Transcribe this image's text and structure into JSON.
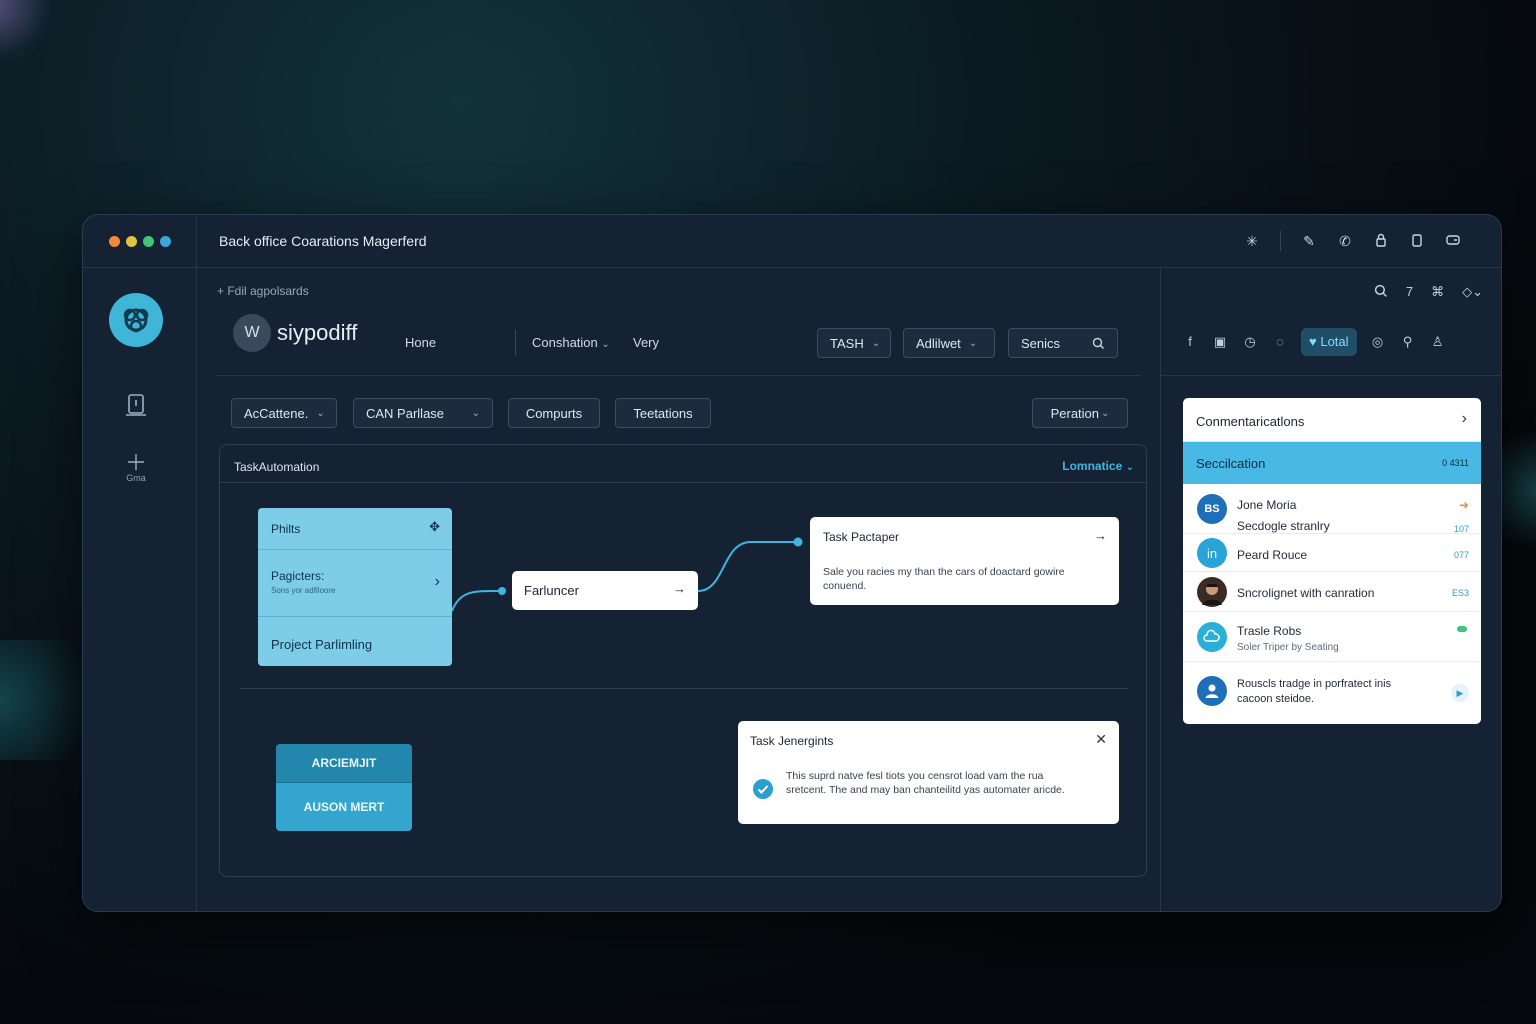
{
  "window": {
    "title": "Back office Coarations Magerferd",
    "dots": [
      "#f08a3c",
      "#e3c33a",
      "#3fc47a",
      "#3aa8d8"
    ],
    "title_icons": [
      "asterisk-icon",
      "tools-icon",
      "phone-icon",
      "lock-icon",
      "clipboard-icon",
      "link-icon"
    ]
  },
  "leftbar": {
    "icons": [
      "logo-icon",
      "badge-icon",
      "plus-icon"
    ],
    "label": "Gma"
  },
  "main": {
    "breadcrumb": "+ Fdil agpolsards",
    "brand_badge": "W",
    "brand_name": "siypodiff",
    "nav": [
      "Hone",
      "Conshation",
      "Very"
    ],
    "buttons": [
      {
        "label": "TASH"
      },
      {
        "label": "Adlilwet"
      },
      {
        "label": "Senics"
      }
    ],
    "filters": [
      {
        "label": "AcCattene."
      },
      {
        "label": "CAN Parllase"
      },
      {
        "label": "Compurts"
      },
      {
        "label": "Teetations"
      }
    ],
    "filter_right": "Peration",
    "panel": {
      "title": "TaskAutomation",
      "right_label": "Lomnatice",
      "node_list": {
        "header": "Philts",
        "row2_title": "Pagicters:",
        "row2_sub": "Sons yor adfiloore",
        "row3": "Project Parlimling"
      },
      "node_mid": "Farluncer",
      "node_right": {
        "title": "Task Pactaper",
        "body": "Sale you racies my than the cars of doactard gowire conuend."
      },
      "arc_top": "ARCIEMJIT",
      "arc_bottom": "AUSON MERT",
      "notice": {
        "title": "Task Jenergints",
        "body": "This suprd natve fesl tiots you censrot load vam the rua sretcent. The and may ban chanteilitd yas automater aricde."
      }
    }
  },
  "rightbar": {
    "top_icons": [
      "search-icon",
      "7",
      "grid-icon",
      "settings-icon"
    ],
    "social_icons": [
      "facebook-icon",
      "camera-icon",
      "clock-icon",
      "chat-icon"
    ],
    "active_tab": "Lotal",
    "social_icons_right": [
      "globe-icon",
      "search-icon",
      "user-icon"
    ],
    "comm": {
      "title": "Conmentaricatlons",
      "selected": "Seccilcation",
      "selected_meta": "0 4311",
      "rows": [
        {
          "avatar": "BS",
          "avatar_color": "#1f6fb8",
          "name": "Jone Moria",
          "sub": "Secdogle stranlry",
          "meta": "107",
          "badge_color": "#f08a3c"
        },
        {
          "avatar": "in",
          "avatar_color": "#2aa3d6",
          "name": "Peard Rouce",
          "sub": "",
          "meta": "077",
          "badge_color": ""
        },
        {
          "avatar": "",
          "avatar_color": "#3a2c24",
          "name": "Sncrolignet with canration",
          "sub": "",
          "meta": "ES3",
          "badge_color": ""
        },
        {
          "avatar": "",
          "avatar_color": "#2ab0d8",
          "name": "Trasle Robs",
          "sub": "Soler Triper by Seating",
          "meta": "",
          "badge_color": "#3fc47a"
        },
        {
          "avatar": "",
          "avatar_color": "#1f6fb8",
          "name": "Rouscls tradge in porfratect inis",
          "sub": "cacoon steidoe.",
          "meta": "",
          "badge_color": "#2a9fd0"
        }
      ]
    }
  }
}
